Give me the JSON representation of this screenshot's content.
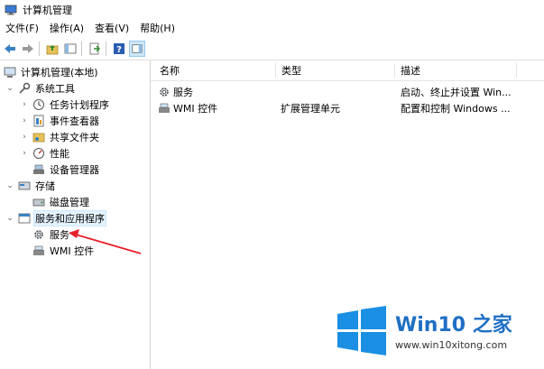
{
  "window": {
    "title": "计算机管理"
  },
  "menu": [
    "文件(F)",
    "操作(A)",
    "查看(V)",
    "帮助(H)"
  ],
  "tree": {
    "root": "计算机管理(本地)",
    "system_tools": "系统工具",
    "task_scheduler": "任务计划程序",
    "event_viewer": "事件查看器",
    "shared_folders": "共享文件夹",
    "performance": "性能",
    "device_manager": "设备管理器",
    "storage": "存储",
    "disk_management": "磁盘管理",
    "services_apps": "服务和应用程序",
    "services": "服务",
    "wmi": "WMI 控件"
  },
  "list": {
    "headers": [
      "名称",
      "类型",
      "描述"
    ],
    "rows": [
      {
        "name": "服务",
        "type": "",
        "desc": "启动、终止并设置 Win..."
      },
      {
        "name": "WMI 控件",
        "type": "扩展管理单元",
        "desc": "配置和控制 Windows ..."
      }
    ]
  },
  "watermark": {
    "brand": "Win10 之家",
    "url": "www.win10xitong.com"
  },
  "colors": {
    "arrow": "#e8202a",
    "logo_blue": "#1a8fe3",
    "brand_blue": "#1f6fc4"
  }
}
